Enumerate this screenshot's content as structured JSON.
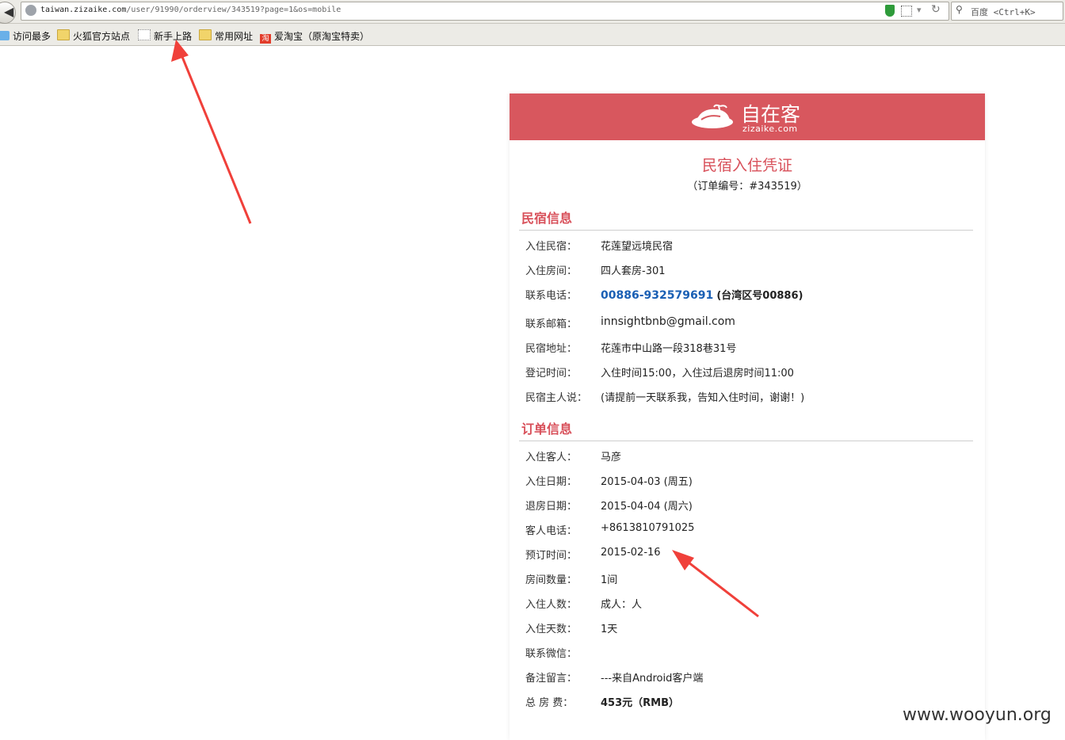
{
  "browser": {
    "url_host": "taiwan.zizaike.com",
    "url_path": "/user/91990/orderview/343519?page=1&os=mobile",
    "search_placeholder": "百度 <Ctrl+K>",
    "bookmarks": [
      {
        "label": "访问最多",
        "icon": "most-visited-icon"
      },
      {
        "label": "火狐官方站点",
        "icon": "folder-icon"
      },
      {
        "label": "新手上路",
        "icon": "page-icon"
      },
      {
        "label": "常用网址",
        "icon": "folder-icon"
      },
      {
        "label": "爱淘宝（原淘宝特卖）",
        "icon": "taobao-icon",
        "icon_text": "淘"
      }
    ]
  },
  "brand": {
    "name_cn": "自在客",
    "name_en": "zizaike.com",
    "color": "#d8575e"
  },
  "voucher": {
    "title": "民宿入住凭证",
    "order_no": "（订单编号：#343519）"
  },
  "bnb_section": {
    "title": "民宿信息",
    "rows": [
      {
        "label": "入住民宿：",
        "value": "花莲望远境民宿"
      },
      {
        "label": "入住房间：",
        "value": "四人套房-301"
      },
      {
        "label": "联系电话：",
        "value": "00886-932579691",
        "note": "(台湾区号00886)"
      },
      {
        "label": "联系邮箱：",
        "value": "innsightbnb@gmail.com"
      },
      {
        "label": "民宿地址：",
        "value": "花莲市中山路一段318巷31号"
      },
      {
        "label": "登记时间：",
        "value": "入住时间15:00，入住过后退房时间11:00"
      },
      {
        "label": "民宿主人说：",
        "value": "(请提前一天联系我，告知入住时间，谢谢！)"
      }
    ]
  },
  "order_section": {
    "title": "订单信息",
    "rows": [
      {
        "label": "入住客人：",
        "value": "马彦"
      },
      {
        "label": "入住日期：",
        "value": "2015-04-03 (周五)"
      },
      {
        "label": "退房日期：",
        "value": "2015-04-04 (周六)"
      },
      {
        "label": "客人电话：",
        "value": "+8613810791025"
      },
      {
        "label": "预订时间：",
        "value": "2015-02-16"
      },
      {
        "label": "房间数量：",
        "value": "1间"
      },
      {
        "label": "入住人数：",
        "value": "成人：人"
      },
      {
        "label": "入住天数：",
        "value": "1天"
      },
      {
        "label": "联系微信：",
        "value": ""
      },
      {
        "label": "备注留言：",
        "value": "---来自Android客户端"
      },
      {
        "label": "总 房 费：",
        "value": "453元（RMB）"
      }
    ]
  },
  "watermark": "www.wooyun.org",
  "annotation_color": "#f0403a"
}
